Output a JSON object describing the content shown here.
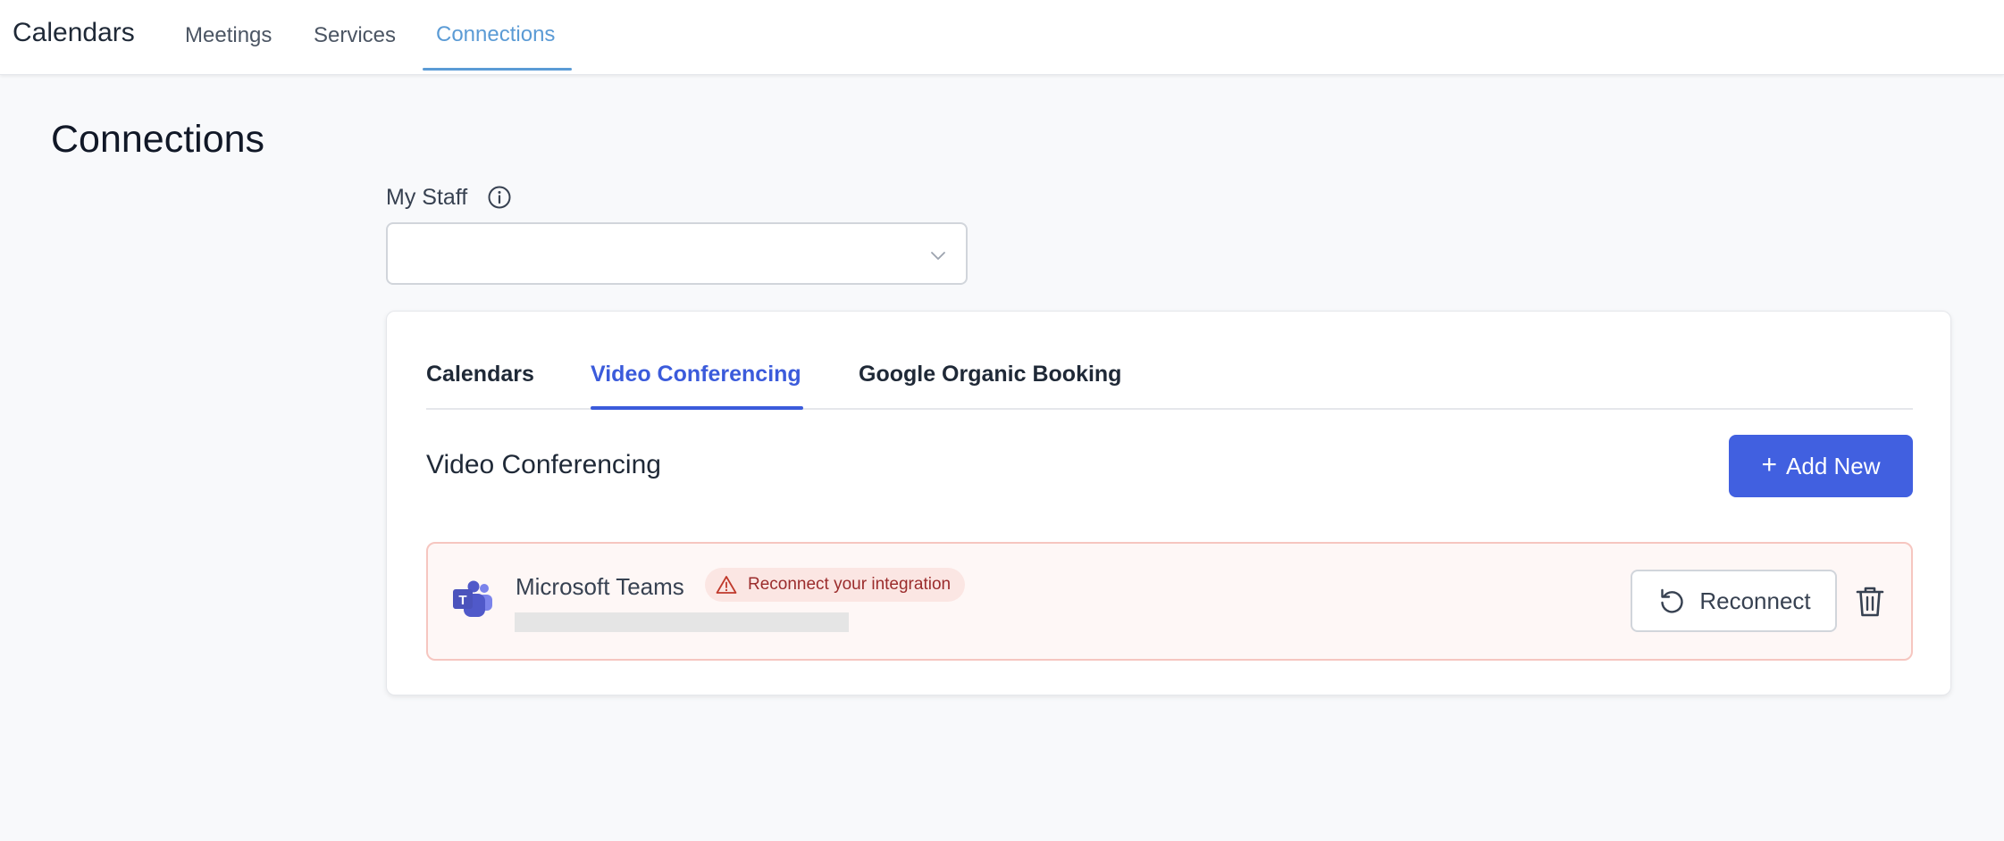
{
  "topnav": {
    "app_title": "Calendars",
    "items": [
      {
        "label": "Meetings"
      },
      {
        "label": "Services"
      },
      {
        "label": "Connections",
        "active": true
      }
    ]
  },
  "page": {
    "title": "Connections"
  },
  "staff": {
    "label": "My Staff",
    "selected_value": ""
  },
  "tabs": [
    {
      "label": "Calendars"
    },
    {
      "label": "Video Conferencing",
      "active": true
    },
    {
      "label": "Google Organic Booking"
    }
  ],
  "section": {
    "title": "Video Conferencing",
    "add_button_label": "Add New"
  },
  "integrations": [
    {
      "name": "Microsoft Teams",
      "warning": "Reconnect your integration",
      "reconnect_label": "Reconnect",
      "icon": "microsoft-teams-logo"
    }
  ],
  "colors": {
    "accent": "#4160e0",
    "nav_active": "#5b9bd5",
    "warning_text": "#9b2c2c",
    "warning_bg": "#fbe6e3",
    "row_bg": "#fef7f6",
    "row_border": "#f6c6c0"
  }
}
